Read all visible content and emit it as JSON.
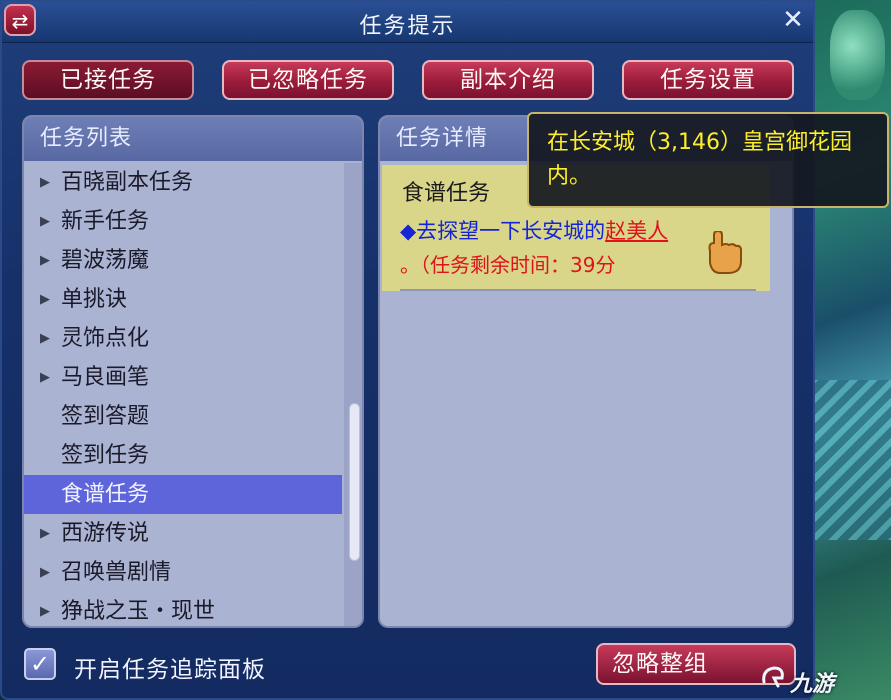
{
  "window": {
    "title": "任务提示",
    "swap_icon": "⇄",
    "close_icon": "✕"
  },
  "tabs": [
    {
      "label": "已接任务",
      "active": true
    },
    {
      "label": "已忽略任务"
    },
    {
      "label": "副本介绍"
    },
    {
      "label": "任务设置"
    }
  ],
  "task_list": {
    "header": "任务列表",
    "items": [
      {
        "label": "百晓副本任务",
        "expandable": true
      },
      {
        "label": "新手任务",
        "expandable": true
      },
      {
        "label": "碧波荡魔",
        "expandable": true
      },
      {
        "label": "单挑诀",
        "expandable": true
      },
      {
        "label": "灵饰点化",
        "expandable": true
      },
      {
        "label": "马良画笔",
        "expandable": true
      },
      {
        "label": "签到答题",
        "expandable": false
      },
      {
        "label": "签到任务",
        "expandable": false
      },
      {
        "label": "食谱任务",
        "expandable": false,
        "selected": true
      },
      {
        "label": "西游传说",
        "expandable": true
      },
      {
        "label": "召唤兽剧情",
        "expandable": true
      },
      {
        "label": "狰战之玉・现世",
        "expandable": true
      }
    ]
  },
  "task_detail": {
    "header": "任务详情",
    "title": "食谱任务",
    "line1_prefix": "◆去探望一下长安城的",
    "npc": "赵美人",
    "line2": "。（任务剩余时间：39分"
  },
  "tooltip": {
    "text": "在长安城（3,146）皇宫御花园内。"
  },
  "footer": {
    "checkbox_label": "开启任务追踪面板",
    "checkbox_checked": true,
    "ignore_button": "忽略整组"
  },
  "watermark": {
    "text": "九游"
  }
}
